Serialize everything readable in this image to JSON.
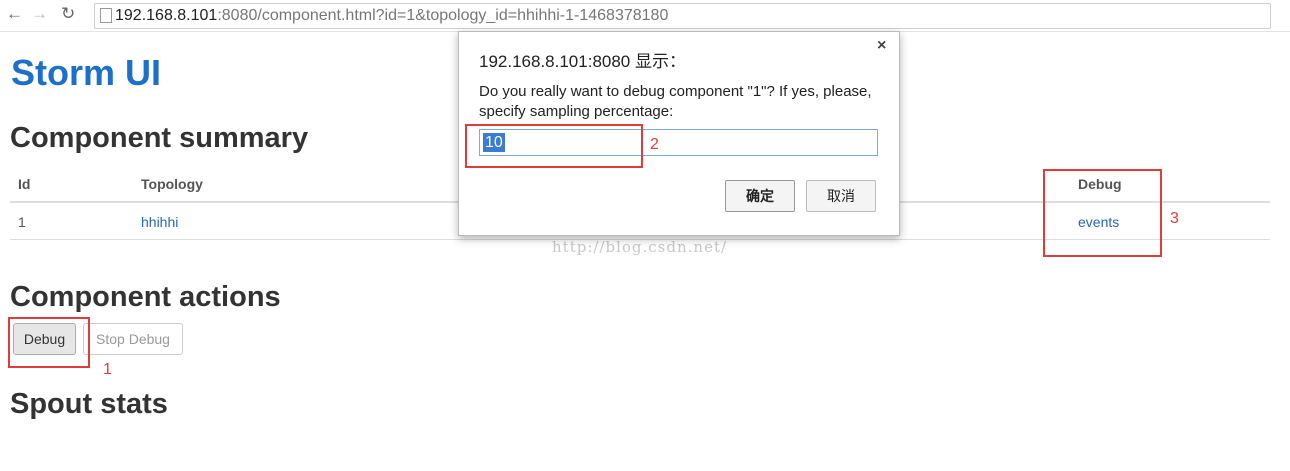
{
  "browser": {
    "url_host": "192.168.8.101",
    "url_rest": ":8080/component.html?id=1&topology_id=hhihhi-1-1468378180"
  },
  "page": {
    "title": "Storm UI",
    "summary_heading": "Component summary",
    "table": {
      "headers": {
        "id": "Id",
        "topology": "Topology",
        "debug": "Debug"
      },
      "rows": [
        {
          "id": "1",
          "topology": "hhihhi",
          "debug": "events"
        }
      ]
    },
    "actions_heading": "Component actions",
    "debug_button": "Debug",
    "stop_debug_button": "Stop Debug",
    "spout_heading": "Spout stats"
  },
  "dialog": {
    "title": "192.168.8.101:8080 显示：",
    "message": "Do you really want to debug component \"1\"? If yes, please, specify sampling percentage:",
    "input_value": "10",
    "ok_label": "确定",
    "cancel_label": "取消"
  },
  "annotations": {
    "n1": "1",
    "n2": "2",
    "n3": "3",
    "color": "#e23b3b"
  },
  "watermark": "http://blog.csdn.net/",
  "colors": {
    "title": "#1c6fcb",
    "link": "#2a66b5"
  }
}
